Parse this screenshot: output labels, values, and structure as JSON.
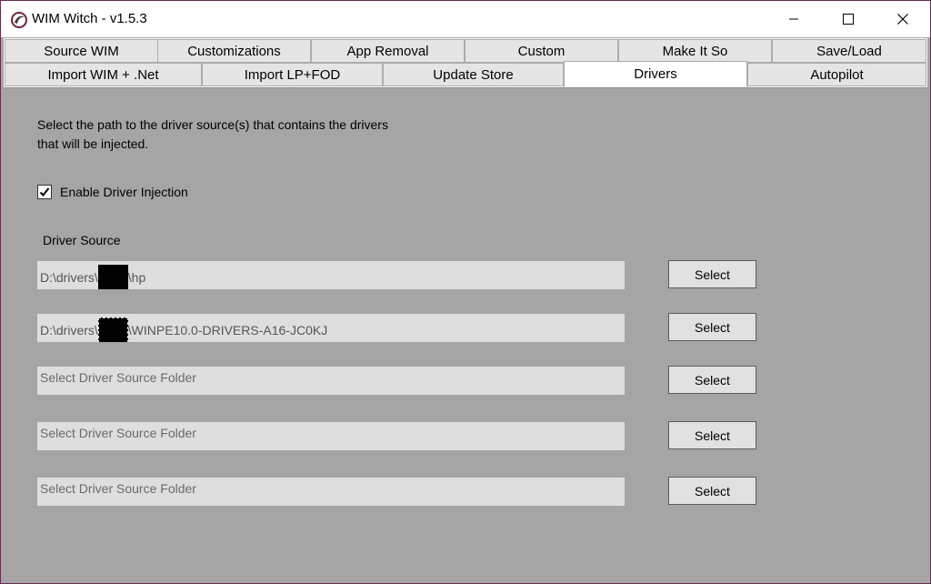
{
  "window": {
    "title": "WIM Witch - v1.5.3"
  },
  "tabs_row1": [
    {
      "label": "Source WIM"
    },
    {
      "label": "Customizations"
    },
    {
      "label": "App Removal"
    },
    {
      "label": "Custom"
    },
    {
      "label": "Make It So"
    },
    {
      "label": "Save/Load"
    }
  ],
  "tabs_row2": [
    {
      "label": "Import WIM + .Net"
    },
    {
      "label": "Import LP+FOD"
    },
    {
      "label": "Update Store"
    },
    {
      "label": "Drivers",
      "selected": true
    },
    {
      "label": "Autopilot"
    }
  ],
  "drivers": {
    "description": "Select the path to the driver source(s) that contains the drivers that will be injected.",
    "description_line1": "Select the path to the driver source(s) that contains the drivers",
    "description_line2": "that will be injected.",
    "enable_label": "Enable Driver Injection",
    "enable_checked": true,
    "source_label": "Driver Source",
    "sources": [
      {
        "prefix": "D:\\drivers\\",
        "suffix": "\\hp",
        "redacted": true
      },
      {
        "prefix": "D:\\drivers\\",
        "suffix": "\\WINPE10.0-DRIVERS-A16-JC0KJ",
        "redacted": true
      },
      {
        "placeholder": "Select Driver Source Folder"
      },
      {
        "placeholder": "Select Driver Source Folder"
      },
      {
        "placeholder": "Select Driver Source Folder"
      }
    ],
    "select_label": "Select"
  },
  "colors": {
    "border_accent": "#6b2b4f",
    "content_bg": "#a5a5a5",
    "field_bg": "#dedede"
  },
  "icons": [
    "witch-app-icon",
    "minimize-icon",
    "maximize-icon",
    "close-icon",
    "checkmark-icon"
  ]
}
